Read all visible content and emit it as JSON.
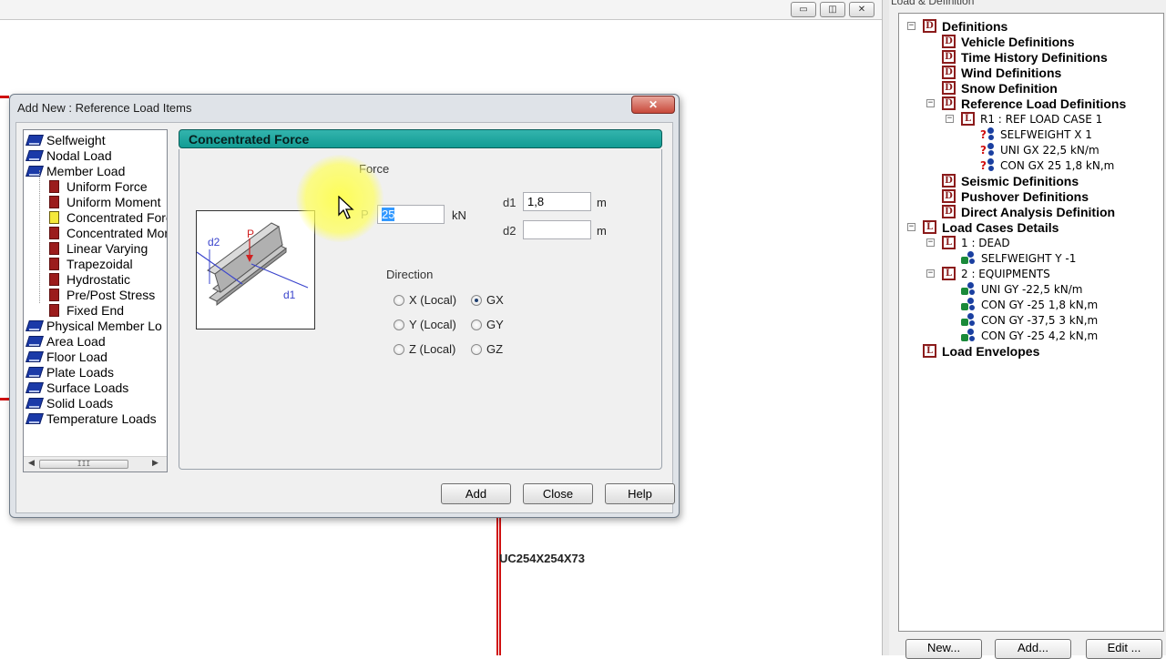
{
  "app": {
    "win_minimize": "▭",
    "win_restore": "◫",
    "win_close": "✕",
    "section_label": "UC254X254X73"
  },
  "panel": {
    "title": "Load & Definition",
    "tree": [
      {
        "label": "Definitions",
        "icon": "D",
        "bold": true
      },
      {
        "label": "Vehicle Definitions",
        "icon": "D",
        "bold": true
      },
      {
        "label": "Time History Definitions",
        "icon": "D",
        "bold": true
      },
      {
        "label": "Wind Definitions",
        "icon": "D",
        "bold": true
      },
      {
        "label": "Snow Definition",
        "icon": "D",
        "bold": true
      },
      {
        "label": "Reference Load Definitions",
        "icon": "D",
        "bold": true
      },
      {
        "label": "R1 : REF LOAD CASE 1",
        "icon": "L",
        "bold": false
      },
      {
        "label": "SELFWEIGHT X 1",
        "icon": "q",
        "bold": false
      },
      {
        "label": "UNI GX 22,5 kN/m",
        "icon": "q",
        "bold": false
      },
      {
        "label": "CON GX 25 1,8 kN,m",
        "icon": "q",
        "bold": false
      },
      {
        "label": "Seismic Definitions",
        "icon": "D",
        "bold": true
      },
      {
        "label": "Pushover Definitions",
        "icon": "D",
        "bold": true
      },
      {
        "label": "Direct Analysis Definition",
        "icon": "D",
        "bold": true
      },
      {
        "label": "Load Cases Details",
        "icon": "L",
        "bold": true
      },
      {
        "label": "1 : DEAD",
        "icon": "L",
        "bold": false
      },
      {
        "label": "SELFWEIGHT Y -1",
        "icon": "g",
        "bold": false
      },
      {
        "label": "2 : EQUIPMENTS",
        "icon": "L",
        "bold": false
      },
      {
        "label": "UNI GY -22,5 kN/m",
        "icon": "g",
        "bold": false
      },
      {
        "label": "CON GY -25 1,8 kN,m",
        "icon": "g",
        "bold": false
      },
      {
        "label": "CON GY -37,5 3 kN,m",
        "icon": "g",
        "bold": false
      },
      {
        "label": "CON GY -25 4,2 kN,m",
        "icon": "g",
        "bold": false
      },
      {
        "label": "Load Envelopes",
        "icon": "L",
        "bold": true
      }
    ],
    "buttons": {
      "new": "New...",
      "add": "Add...",
      "edit": "Edit ..."
    }
  },
  "dialog": {
    "title": "Add New : Reference Load Items",
    "close_glyph": "✕",
    "items": [
      {
        "label": "Selfweight",
        "type": "book"
      },
      {
        "label": "Nodal Load",
        "type": "book"
      },
      {
        "label": "Member Load",
        "type": "book"
      },
      {
        "label": "Uniform Force",
        "type": "page"
      },
      {
        "label": "Uniform Moment",
        "type": "page"
      },
      {
        "label": "Concentrated Forc",
        "type": "page-selected"
      },
      {
        "label": "Concentrated Mor",
        "type": "page"
      },
      {
        "label": "Linear Varying",
        "type": "page"
      },
      {
        "label": "Trapezoidal",
        "type": "page"
      },
      {
        "label": "Hydrostatic",
        "type": "page"
      },
      {
        "label": "Pre/Post Stress",
        "type": "page"
      },
      {
        "label": "Fixed End",
        "type": "page"
      },
      {
        "label": "Physical Member Lo",
        "type": "book"
      },
      {
        "label": "Area Load",
        "type": "book"
      },
      {
        "label": "Floor Load",
        "type": "book"
      },
      {
        "label": "Plate Loads",
        "type": "book"
      },
      {
        "label": "Surface Loads",
        "type": "book"
      },
      {
        "label": "Solid Loads",
        "type": "book"
      },
      {
        "label": "Temperature Loads",
        "type": "book"
      }
    ],
    "scroll": {
      "left": "◀",
      "right": "▶",
      "thumb": "III"
    },
    "header": "Concentrated Force",
    "diagram": {
      "p": "P",
      "d1": "d1",
      "d2": "d2"
    },
    "force": {
      "group_label": "Force",
      "p_label": "P",
      "p_value": "25",
      "p_unit": "kN",
      "d1_label": "d1",
      "d1_value": "1,8",
      "d1_unit": "m",
      "d2_label": "d2",
      "d2_value": "",
      "d2_unit": "m"
    },
    "direction": {
      "group_label": "Direction",
      "options": [
        {
          "label": "X (Local)",
          "checked": false
        },
        {
          "label": "GX",
          "checked": true
        },
        {
          "label": "Y (Local)",
          "checked": false
        },
        {
          "label": "GY",
          "checked": false
        },
        {
          "label": "Z (Local)",
          "checked": false
        },
        {
          "label": "GZ",
          "checked": false
        }
      ]
    },
    "buttons": {
      "add": "Add",
      "close": "Close",
      "help": "Help"
    }
  }
}
